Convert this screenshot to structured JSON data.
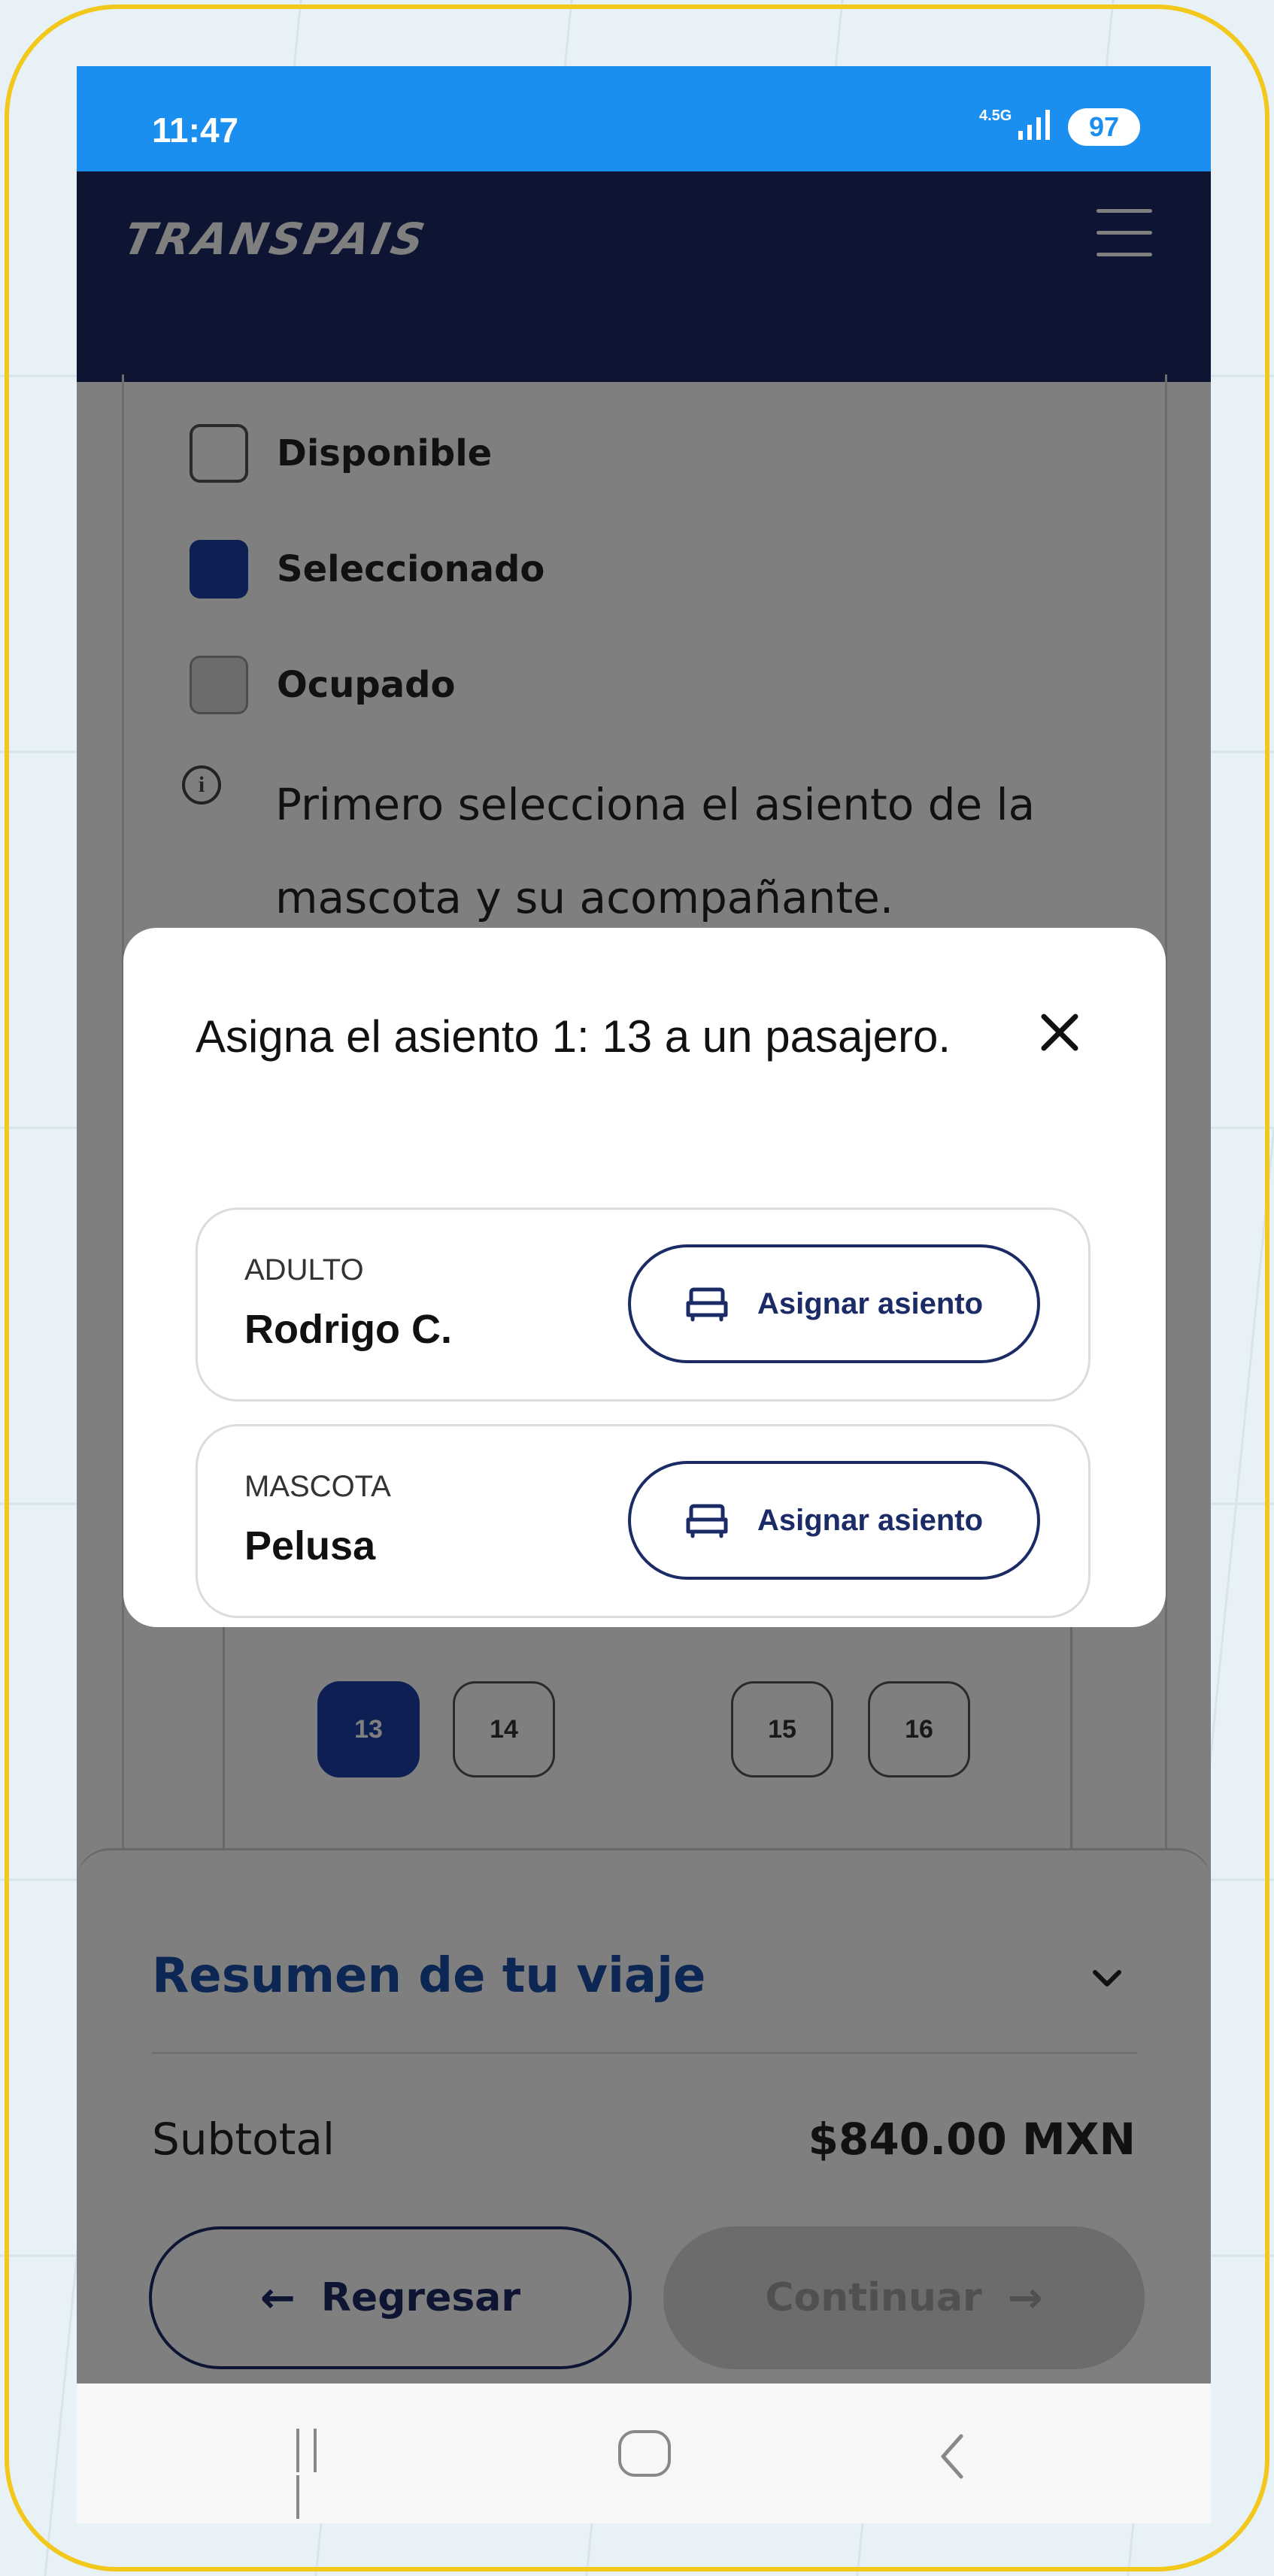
{
  "status_bar": {
    "time": "11:47",
    "network": "4.5G",
    "battery": "97"
  },
  "header": {
    "brand": "TRANSPAIS"
  },
  "legend": {
    "available": "Disponible",
    "selected": "Seleccionado",
    "occupied": "Ocupado"
  },
  "info_note": "Primero selecciona el asiento de la mascota y su acompañante.",
  "seats": [
    {
      "number": "13",
      "state": "selected"
    },
    {
      "number": "14",
      "state": "available"
    },
    {
      "number": "15",
      "state": "available"
    },
    {
      "number": "16",
      "state": "available"
    }
  ],
  "modal": {
    "title": "Asigna el asiento 1: 13 a un pasajero.",
    "passengers": [
      {
        "type": "ADULTO",
        "name": "Rodrigo C.",
        "button": "Asignar asiento"
      },
      {
        "type": "MASCOTA",
        "name": "Pelusa",
        "button": "Asignar asiento"
      }
    ]
  },
  "summary": {
    "title": "Resumen de tu viaje",
    "subtotal_label": "Subtotal",
    "subtotal_value": "$840.00 MXN",
    "back_button": "Regresar",
    "continue_button": "Continuar"
  },
  "colors": {
    "status_bar": "#1a8ff0",
    "header": "#1b2b65",
    "accent_blue": "#1d3fa8",
    "frame": "#f2c81c"
  }
}
